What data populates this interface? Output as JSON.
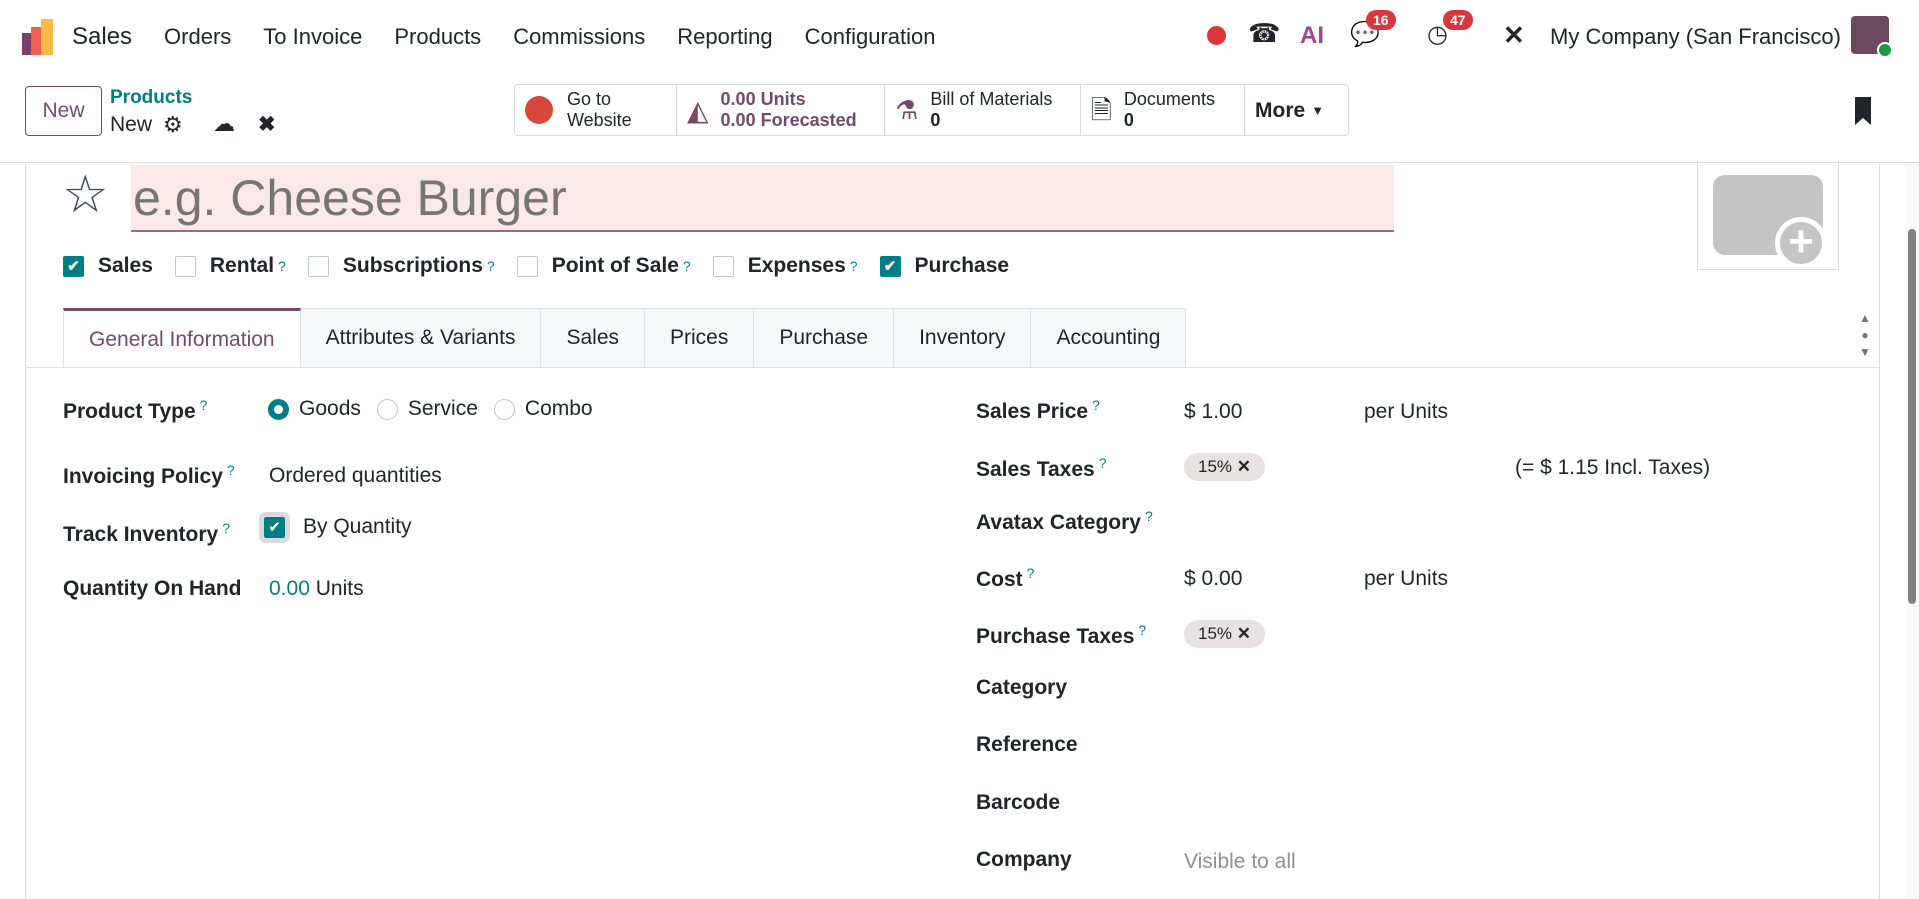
{
  "nav": {
    "app": "Sales",
    "menu": [
      "Orders",
      "To Invoice",
      "Products",
      "Commissions",
      "Reporting",
      "Configuration"
    ],
    "messages_count": "16",
    "activities_count": "47",
    "ai_label": "AI",
    "company": "My Company (San Francisco)"
  },
  "control": {
    "new_label": "New",
    "breadcrumb_parent": "Products",
    "breadcrumb_current": "New",
    "smart_buttons": {
      "website_l1": "Go to",
      "website_l2": "Website",
      "units": "0.00 Units",
      "forecasted": "0.00 Forecasted",
      "bom_label": "Bill of Materials",
      "bom_count": "0",
      "docs_label": "Documents",
      "docs_count": "0",
      "more": "More"
    }
  },
  "form": {
    "name_placeholder": "e.g. Cheese Burger",
    "options": [
      {
        "label": "Sales",
        "checked": true,
        "help": false
      },
      {
        "label": "Rental",
        "checked": false,
        "help": true
      },
      {
        "label": "Subscriptions",
        "checked": false,
        "help": true
      },
      {
        "label": "Point of Sale",
        "checked": false,
        "help": true
      },
      {
        "label": "Expenses",
        "checked": false,
        "help": true
      },
      {
        "label": "Purchase",
        "checked": true,
        "help": false
      }
    ],
    "tabs": [
      "General Information",
      "Attributes & Variants",
      "Sales",
      "Prices",
      "Purchase",
      "Inventory",
      "Accounting"
    ],
    "left": {
      "product_type_label": "Product Type",
      "types": [
        "Goods",
        "Service",
        "Combo"
      ],
      "invoicing_label": "Invoicing Policy",
      "invoicing_value": "Ordered quantities",
      "track_label": "Track Inventory",
      "track_value": "By Quantity",
      "qty_label": "Quantity On Hand",
      "qty_value": "0.00",
      "qty_unit": "Units"
    },
    "right": {
      "sales_price_label": "Sales Price",
      "sales_price": "$ 1.00",
      "per_units": "per Units",
      "sales_taxes_label": "Sales Taxes",
      "sales_tax_tag": "15%",
      "incl_taxes": "(= $ 1.15 Incl. Taxes)",
      "avatax_label": "Avatax Category",
      "cost_label": "Cost",
      "cost": "$ 0.00",
      "purchase_taxes_label": "Purchase Taxes",
      "purchase_tax_tag": "15%",
      "category_label": "Category",
      "reference_label": "Reference",
      "barcode_label": "Barcode",
      "company_label": "Company",
      "company_placeholder": "Visible to all"
    }
  },
  "help_mark": "?",
  "colors": {
    "primary": "#714b67",
    "teal": "#017e84",
    "badge": "#d9363e"
  }
}
